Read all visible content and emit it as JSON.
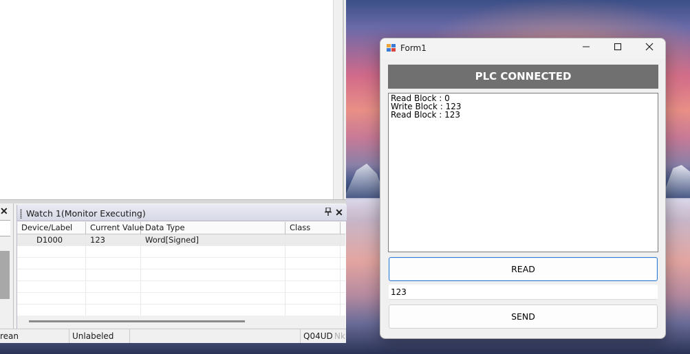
{
  "ide": {
    "watch_panel": {
      "title": "Watch 1(Monitor Executing)",
      "columns": [
        "Device/Label",
        "Current Value",
        "Data Type",
        "Class"
      ],
      "rows": [
        {
          "device": "D1000",
          "value": "123",
          "type": "Word[Signed]",
          "class": ""
        }
      ]
    },
    "statusbar": {
      "language": "rean",
      "label_mode": "Unlabeled",
      "cpu": "Q04UD",
      "extra": "Nk"
    }
  },
  "form1": {
    "title": "Form1",
    "status_banner": "PLC CONNECTED",
    "log_lines": [
      "Read Block : 0",
      "Write Block : 123",
      "Read Block : 123"
    ],
    "read_button": "READ",
    "value_input": "123",
    "send_button": "SEND",
    "titlebar": {
      "minimize": "—",
      "maximize": "☐",
      "close": "✕"
    }
  },
  "icons": {
    "pin": "pin-icon",
    "close": "close-icon",
    "app": "form-app-icon"
  }
}
